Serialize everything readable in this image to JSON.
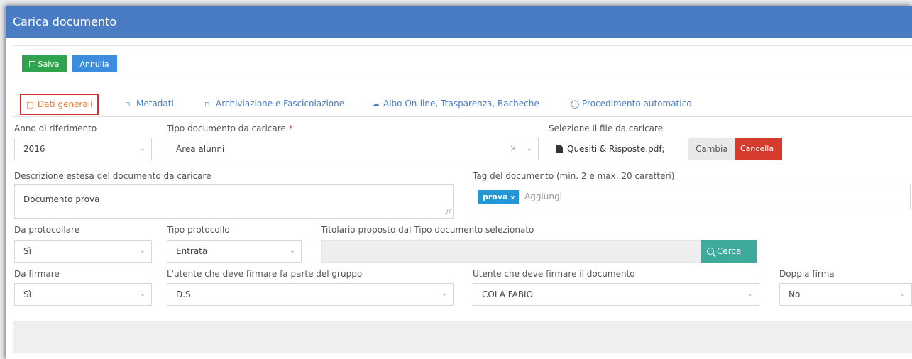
{
  "window": {
    "title": "Carica documento"
  },
  "toolbar": {
    "save_label": "Salva",
    "cancel_label": "Annulla"
  },
  "tabs": [
    {
      "label": "Dati generali",
      "icon": "file-icon"
    },
    {
      "label": "Metadati",
      "icon": "folder-icon"
    },
    {
      "label": "Archiviazione e Fascicolazione",
      "icon": "folder-icon"
    },
    {
      "label": "Albo On-line, Trasparenza, Bacheche",
      "icon": "cloud-icon"
    },
    {
      "label": "Procedimento automatico",
      "icon": "refresh-icon"
    }
  ],
  "form": {
    "anno": {
      "label": "Anno di riferimento",
      "value": "2016"
    },
    "tipo_documento": {
      "label": "Tipo documento da caricare",
      "required": "*",
      "value": "Area alunni"
    },
    "file": {
      "label": "Selezione il file da caricare",
      "value": "Quesiti & Risposte.pdf;",
      "change_label": "Cambia",
      "delete_label": "Cancella"
    },
    "descrizione": {
      "label": "Descrizione estesa del documento da caricare",
      "value": "Documento prova"
    },
    "tag": {
      "label": "Tag del documento (min. 2 e max. 20 caratteri)",
      "tags": [
        "prova"
      ],
      "remove_glyph": "x",
      "placeholder": "Aggiungi"
    },
    "da_protocollare": {
      "label": "Da protocollare",
      "value": "Sì"
    },
    "tipo_protocollo": {
      "label": "Tipo protocollo",
      "value": "Entrata"
    },
    "titolario": {
      "label": "Titolario proposto dal Tipo documento selezionato",
      "value": "",
      "search_label": "Cerca"
    },
    "da_firmare": {
      "label": "Da firmare",
      "value": "Sì"
    },
    "gruppo": {
      "label": "L'utente che deve firmare fa parte del gruppo",
      "value": "D.S."
    },
    "utente": {
      "label": "Utente che deve firmare il documento",
      "value": "COLA FABIO"
    },
    "doppia_firma": {
      "label": "Doppia firma",
      "value": "No"
    }
  },
  "colors": {
    "titlebar": "#4a7cc4",
    "save": "#2ea44f",
    "cancel": "#3c8dde",
    "active_tab": "#e8762d",
    "delete": "#d63c2e",
    "search": "#3daa9b",
    "tag": "#2396d6"
  }
}
